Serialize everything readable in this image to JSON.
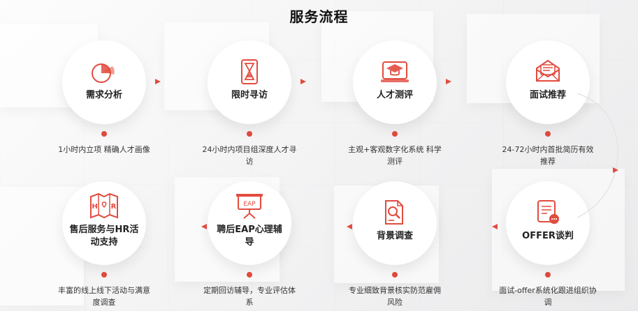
{
  "title": "服务流程",
  "steps": [
    {
      "title": "需求分析",
      "desc": "1小时内立项 精确人才画像",
      "icon": "pie-chart-icon"
    },
    {
      "title": "限时寻访",
      "desc": "24小时内项目组深度人才寻访",
      "icon": "hourglass-icon"
    },
    {
      "title": "人才测评",
      "desc": "主观+客观数字化系统 科学测评",
      "icon": "graduation-cap-icon"
    },
    {
      "title": "面试推荐",
      "desc": "24-72小时内首批简历有效推荐",
      "icon": "envelope-icon"
    },
    {
      "title": "OFFER谈判",
      "desc": "面试-offer系统化跟进组织协调",
      "icon": "document-chat-icon"
    },
    {
      "title": "背景调查",
      "desc": "专业细致背景核实防范雇佣风险",
      "icon": "document-magnifier-icon"
    },
    {
      "title": "聘后EAP心理辅导",
      "desc": "定期回访辅导，专业评估体系",
      "icon": "presentation-board-icon"
    },
    {
      "title": "售后服务与HR活动支持",
      "desc": "丰富的线上线下活动与满意度调查",
      "icon": "map-hr-icon"
    }
  ],
  "colors": {
    "accent": "#e24b3e",
    "text": "#222222"
  }
}
